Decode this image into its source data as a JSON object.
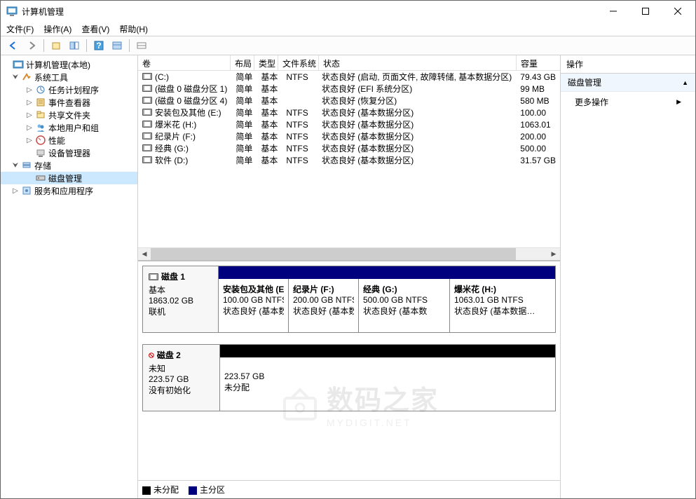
{
  "title": "计算机管理",
  "menus": [
    "文件(F)",
    "操作(A)",
    "查看(V)",
    "帮助(H)"
  ],
  "tree": {
    "root": "计算机管理(本地)",
    "system_tools": "系统工具",
    "task_scheduler": "任务计划程序",
    "event_viewer": "事件查看器",
    "shared_folders": "共享文件夹",
    "local_users": "本地用户和组",
    "performance": "性能",
    "device_manager": "设备管理器",
    "storage": "存储",
    "disk_management": "磁盘管理",
    "services_apps": "服务和应用程序"
  },
  "columns": {
    "volume": "卷",
    "layout": "布局",
    "type": "类型",
    "filesystem": "文件系统",
    "status": "状态",
    "capacity": "容量"
  },
  "volumes": [
    {
      "name": "(C:)",
      "layout": "简单",
      "type": "基本",
      "fs": "NTFS",
      "status": "状态良好 (启动, 页面文件, 故障转储, 基本数据分区)",
      "capacity": "79.43 GB"
    },
    {
      "name": "(磁盘 0 磁盘分区 1)",
      "layout": "简单",
      "type": "基本",
      "fs": "",
      "status": "状态良好 (EFI 系统分区)",
      "capacity": "99 MB"
    },
    {
      "name": "(磁盘 0 磁盘分区 4)",
      "layout": "简单",
      "type": "基本",
      "fs": "",
      "status": "状态良好 (恢复分区)",
      "capacity": "580 MB"
    },
    {
      "name": "安装包及其他 (E:)",
      "layout": "简单",
      "type": "基本",
      "fs": "NTFS",
      "status": "状态良好 (基本数据分区)",
      "capacity": "100.00"
    },
    {
      "name": "爆米花 (H:)",
      "layout": "简单",
      "type": "基本",
      "fs": "NTFS",
      "status": "状态良好 (基本数据分区)",
      "capacity": "1063.01"
    },
    {
      "name": "纪录片 (F:)",
      "layout": "简单",
      "type": "基本",
      "fs": "NTFS",
      "status": "状态良好 (基本数据分区)",
      "capacity": "200.00"
    },
    {
      "name": "经典 (G:)",
      "layout": "简单",
      "type": "基本",
      "fs": "NTFS",
      "status": "状态良好 (基本数据分区)",
      "capacity": "500.00"
    },
    {
      "name": "软件 (D:)",
      "layout": "简单",
      "type": "基本",
      "fs": "NTFS",
      "status": "状态良好 (基本数据分区)",
      "capacity": "31.57 GB"
    }
  ],
  "disk1": {
    "title": "磁盘 1",
    "type": "基本",
    "size": "1863.02 GB",
    "state": "联机",
    "parts": [
      {
        "name": "安装包及其他  (E",
        "size": "100.00 GB NTFS",
        "status": "状态良好 (基本数"
      },
      {
        "name": "纪录片  (F:)",
        "size": "200.00 GB NTFS",
        "status": "状态良好 (基本数"
      },
      {
        "name": "经典  (G:)",
        "size": "500.00 GB NTFS",
        "status": "状态良好 (基本数"
      },
      {
        "name": "爆米花  (H:)",
        "size": "1063.01 GB NTFS",
        "status": "状态良好 (基本数据…"
      }
    ]
  },
  "disk2": {
    "title": "磁盘 2",
    "type": "未知",
    "size": "223.57 GB",
    "state": "没有初始化",
    "part_size": "223.57 GB",
    "part_state": "未分配"
  },
  "legend": {
    "unalloc": "未分配",
    "primary": "主分区"
  },
  "actions": {
    "header": "操作",
    "disk_mgmt": "磁盘管理",
    "more": "更多操作"
  },
  "watermark": {
    "t1": "数码之家",
    "t2": "MYDIGIT.NET"
  }
}
